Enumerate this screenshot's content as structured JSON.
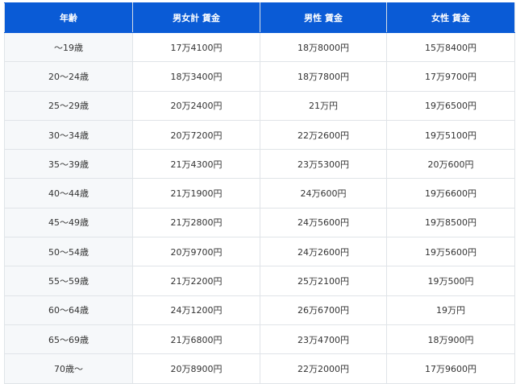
{
  "table": {
    "headers": [
      "年齢",
      "男女計 賃金",
      "男性 賃金",
      "女性 賃金"
    ],
    "rows": [
      [
        "〜19歳",
        "17万4100円",
        "18万8000円",
        "15万8400円"
      ],
      [
        "20〜24歳",
        "18万3400円",
        "18万7800円",
        "17万9700円"
      ],
      [
        "25〜29歳",
        "20万2400円",
        "21万円",
        "19万6500円"
      ],
      [
        "30〜34歳",
        "20万7200円",
        "22万2600円",
        "19万5100円"
      ],
      [
        "35〜39歳",
        "21万4300円",
        "23万5300円",
        "20万600円"
      ],
      [
        "40〜44歳",
        "21万1900円",
        "24万600円",
        "19万6600円"
      ],
      [
        "45〜49歳",
        "21万2800円",
        "24万5600円",
        "19万8500円"
      ],
      [
        "50〜54歳",
        "20万9700円",
        "24万2600円",
        "19万5600円"
      ],
      [
        "55〜59歳",
        "21万2200円",
        "25万2100円",
        "19万500円"
      ],
      [
        "60〜64歳",
        "24万1200円",
        "26万6700円",
        "19万円"
      ],
      [
        "65〜69歳",
        "21万6800円",
        "23万4700円",
        "18万900円"
      ],
      [
        "70歳〜",
        "20万8900円",
        "22万2000円",
        "17万9600円"
      ]
    ]
  },
  "colors": {
    "header_bg": "#0a5bd6",
    "header_text": "#ffffff",
    "age_col_bg": "#f6f8fa",
    "border": "#e0e4e8"
  }
}
